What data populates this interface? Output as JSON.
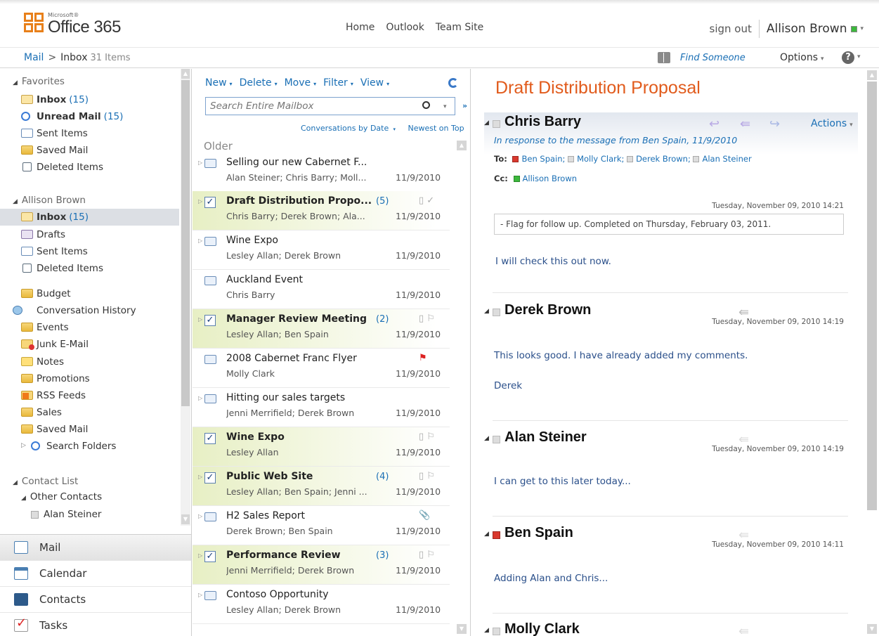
{
  "header": {
    "logo_small": "Microsoft®",
    "logo_brand": "Office 365",
    "nav": [
      "Home",
      "Outlook",
      "Team Site"
    ],
    "sign_out": "sign out",
    "user_name": "Allison Brown"
  },
  "breadcrumb": {
    "root": "Mail",
    "separator": ">",
    "current": "Inbox",
    "count": "31 Items"
  },
  "toprow": {
    "find_someone": "Find Someone",
    "options": "Options",
    "help": "?"
  },
  "folders": {
    "favorites_label": "Favorites",
    "favorites": [
      {
        "name": "Inbox",
        "count": "(15)",
        "icon": "inbox-icon",
        "bold": true
      },
      {
        "name": "Unread Mail",
        "count": "(15)",
        "icon": "search-folder-icon",
        "bold": true
      },
      {
        "name": "Sent Items",
        "count": "",
        "icon": "sent-items-icon",
        "bold": false
      },
      {
        "name": "Saved Mail",
        "count": "",
        "icon": "folder-icon",
        "bold": false
      },
      {
        "name": "Deleted Items",
        "count": "",
        "icon": "trash-icon",
        "bold": false
      }
    ],
    "mailbox_label": "Allison Brown",
    "mailbox": [
      {
        "name": "Inbox",
        "count": "(15)",
        "icon": "inbox-icon",
        "bold": true,
        "selected": true
      },
      {
        "name": "Drafts",
        "count": "",
        "icon": "drafts-icon",
        "bold": false
      },
      {
        "name": "Sent Items",
        "count": "",
        "icon": "sent-items-icon",
        "bold": false
      },
      {
        "name": "Deleted Items",
        "count": "",
        "icon": "trash-icon",
        "bold": false
      }
    ],
    "custom": [
      {
        "name": "Budget",
        "icon": "folder-icon"
      },
      {
        "name": "Conversation History",
        "icon": "conversation-history-icon"
      },
      {
        "name": "Events",
        "icon": "folder-icon"
      },
      {
        "name": "Junk E-Mail",
        "icon": "junk-mail-icon"
      },
      {
        "name": "Notes",
        "icon": "notes-icon"
      },
      {
        "name": "Promotions",
        "icon": "folder-icon"
      },
      {
        "name": "RSS Feeds",
        "icon": "rss-feeds-icon"
      },
      {
        "name": "Sales",
        "icon": "folder-icon"
      },
      {
        "name": "Saved Mail",
        "icon": "folder-icon"
      },
      {
        "name": "Search Folders",
        "icon": "search-folder-icon"
      }
    ],
    "contacts_label": "Contact List",
    "other_contacts_label": "Other Contacts",
    "contacts": [
      "Alan Steiner"
    ]
  },
  "modules": [
    "Mail",
    "Calendar",
    "Contacts",
    "Tasks"
  ],
  "list": {
    "toolbar": [
      "New",
      "Delete",
      "Move",
      "Filter",
      "View"
    ],
    "search_placeholder": "Search Entire Mailbox",
    "sort_by": "Conversations by Date",
    "sort_order": "Newest on Top",
    "group_label": "Older",
    "messages": [
      {
        "subject": "Selling our new Cabernet F...",
        "from": "Alan Steiner; Chris Barry; Moll...",
        "date": "11/9/2010",
        "count": "",
        "unread": false,
        "conversation": true,
        "flag": ""
      },
      {
        "subject": "Draft Distribution Propo...",
        "from": "Chris Barry; Derek Brown; Ala...",
        "date": "11/9/2010",
        "count": "(5)",
        "unread": true,
        "conversation": true,
        "flag": "▯ ✓"
      },
      {
        "subject": "Wine Expo",
        "from": "Lesley Allan; Derek Brown",
        "date": "11/9/2010",
        "count": "",
        "unread": false,
        "conversation": true,
        "flag": ""
      },
      {
        "subject": "Auckland Event",
        "from": "Chris Barry",
        "date": "11/9/2010",
        "count": "",
        "unread": false,
        "conversation": false,
        "flag": ""
      },
      {
        "subject": "Manager Review Meeting",
        "from": "Lesley Allan; Ben Spain",
        "date": "11/9/2010",
        "count": "(2)",
        "unread": true,
        "conversation": true,
        "flag": "▯ ⚐"
      },
      {
        "subject": "2008 Cabernet Franc Flyer",
        "from": "Molly Clark",
        "date": "11/9/2010",
        "count": "",
        "unread": false,
        "conversation": false,
        "flag": "⚑"
      },
      {
        "subject": "Hitting our sales targets",
        "from": "Jenni Merrifield; Derek Brown",
        "date": "11/9/2010",
        "count": "",
        "unread": false,
        "conversation": true,
        "flag": ""
      },
      {
        "subject": "Wine Expo",
        "from": "Lesley Allan",
        "date": "11/9/2010",
        "count": "",
        "unread": true,
        "conversation": false,
        "flag": "▯ ⚐"
      },
      {
        "subject": "Public Web Site",
        "from": "Lesley Allan; Ben Spain; Jenni ...",
        "date": "11/9/2010",
        "count": "(4)",
        "unread": true,
        "conversation": true,
        "flag": "▯ ⚐"
      },
      {
        "subject": "H2 Sales Report",
        "from": "Derek Brown; Ben Spain",
        "date": "11/9/2010",
        "count": "",
        "unread": false,
        "conversation": true,
        "flag": "📎"
      },
      {
        "subject": "Performance Review",
        "from": "Jenni Merrifield; Derek Brown",
        "date": "11/9/2010",
        "count": "(3)",
        "unread": true,
        "conversation": true,
        "flag": "▯ ⚐"
      },
      {
        "subject": "Contoso Opportunity",
        "from": "Lesley Allan; Derek Brown",
        "date": "11/9/2010",
        "count": "",
        "unread": false,
        "conversation": true,
        "flag": ""
      }
    ]
  },
  "reading": {
    "title": "Draft Distribution Proposal",
    "first": {
      "sender": "Chris Barry",
      "in_response": "In response to the message from Ben Spain, 11/9/2010",
      "actions": "Actions",
      "to_label": "To:",
      "to": [
        "Ben Spain;",
        "Molly Clark;",
        "Derek Brown;",
        "Alan Steiner"
      ],
      "cc_label": "Cc:",
      "cc": [
        "Allison Brown"
      ],
      "time": "Tuesday, November 09, 2010 14:21",
      "flag_note": "- Flag for follow up. Completed on Thursday, February 03, 2011.",
      "body": "I will check this out now."
    },
    "messages": [
      {
        "sender": "Derek Brown",
        "time": "Tuesday, November 09, 2010 14:19",
        "body": [
          "This looks good. I have already added my comments.",
          "Derek"
        ]
      },
      {
        "sender": "Alan Steiner",
        "time": "Tuesday, November 09, 2010 14:19",
        "body": [
          "I can get to this later today..."
        ]
      },
      {
        "sender": "Ben Spain",
        "time": "Tuesday, November 09, 2010 14:11",
        "body": [
          "Adding Alan and Chris..."
        ]
      },
      {
        "sender": "Molly Clark",
        "time": "",
        "body": []
      }
    ]
  }
}
